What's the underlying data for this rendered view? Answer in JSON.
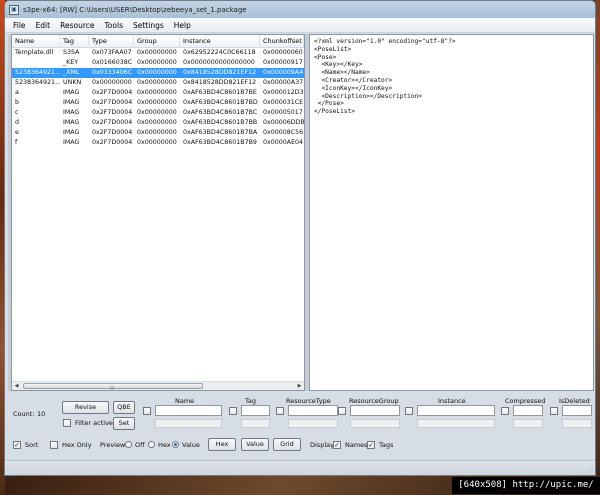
{
  "window": {
    "title": "s3pe-x64: [RW] C:\\Users\\USER\\Desktop\\zebeeya_set_1.package"
  },
  "menu": [
    {
      "label": "File"
    },
    {
      "label": "Edit"
    },
    {
      "label": "Resource"
    },
    {
      "label": "Tools"
    },
    {
      "label": "Settings"
    },
    {
      "label": "Help"
    }
  ],
  "list": {
    "columns": [
      "Name",
      "Tag",
      "Type",
      "Group",
      "Instance",
      "Chunkoffset"
    ],
    "rows": [
      {
        "name": "Template.dll",
        "tag": "S3SA",
        "type": "0x073FAA07",
        "group": "0x00000000",
        "instance": "0x62952224C0C66118",
        "chunk": "0x00000060",
        "selected": false
      },
      {
        "name": "",
        "tag": "_KEY",
        "type": "0x0166038C",
        "group": "0x00000000",
        "instance": "0x0000000000000000",
        "chunk": "0x00000917",
        "selected": false
      },
      {
        "name": "5238364921...",
        "tag": "_XML",
        "type": "0x0333406C",
        "group": "0x00000000",
        "instance": "0x8418528DD821EF12",
        "chunk": "0x000009A4",
        "selected": true
      },
      {
        "name": "5238364921...",
        "tag": "UNKN",
        "type": "0x00000000",
        "group": "0x00000000",
        "instance": "0x8418528DD821EF12",
        "chunk": "0x00000A37",
        "selected": false
      },
      {
        "name": "a",
        "tag": "IMAG",
        "type": "0x2F7D0004",
        "group": "0x00000000",
        "instance": "0xAF63BD4C8601B7BE",
        "chunk": "0x000012D3",
        "selected": false
      },
      {
        "name": "b",
        "tag": "IMAG",
        "type": "0x2F7D0004",
        "group": "0x00000000",
        "instance": "0xAF63BD4C8601B7BD",
        "chunk": "0x000031CE",
        "selected": false
      },
      {
        "name": "c",
        "tag": "IMAG",
        "type": "0x2F7D0004",
        "group": "0x00000000",
        "instance": "0xAF63BD4C8601B7BC",
        "chunk": "0x00005017",
        "selected": false
      },
      {
        "name": "d",
        "tag": "IMAG",
        "type": "0x2F7D0004",
        "group": "0x00000000",
        "instance": "0xAF63BD4C8601B7BB",
        "chunk": "0x00006DDB",
        "selected": false
      },
      {
        "name": "e",
        "tag": "IMAG",
        "type": "0x2F7D0004",
        "group": "0x00000000",
        "instance": "0xAF63BD4C8601B7BA",
        "chunk": "0x00008C56",
        "selected": false
      },
      {
        "name": "f",
        "tag": "IMAG",
        "type": "0x2F7D0004",
        "group": "0x00000000",
        "instance": "0xAF63BD4C8601B7B9",
        "chunk": "0x0000AE04",
        "selected": false
      }
    ]
  },
  "xml_preview": {
    "lines": [
      "<?xml version=\"1.0\" encoding=\"utf-8\"?>",
      "<PoseList>",
      "<Pose>",
      "  <Key></Key>",
      "  <Name></Name>",
      "  <Creator></Creator>",
      "  <IconKey></IconKey>",
      "  <Description></Description>",
      " </Pose>",
      "</PoseList>"
    ]
  },
  "controls": {
    "count_label": "Count:",
    "count_value": "10",
    "revise_label": "Revise",
    "qbe_label": "QBE",
    "filter_active_label": "Filter active",
    "set_label": "Set",
    "filter_headers": {
      "name": "Name",
      "tag": "Tag",
      "resource_type": "ResourceType",
      "resource_group": "ResourceGroup",
      "instance": "Instance",
      "compressed": "Compressed",
      "is_deleted": "IsDeleted"
    },
    "sort_label": "Sort",
    "sort_checked": true,
    "hex_only_label": "Hex Only",
    "hex_only_checked": false,
    "preview_label": "Preview:",
    "preview_options": [
      "Off",
      "Hex",
      "Value"
    ],
    "preview_selected": "Value",
    "hex_button": "Hex",
    "value_button": "Value",
    "grid_button": "Grid",
    "display_label": "Display:",
    "names_label": "Names",
    "names_checked": true,
    "tags_label": "Tags",
    "tags_checked": true
  },
  "watermark": "[640x508] http://upic.me/",
  "colors": {
    "selection": "#3399ff",
    "window_bg": "#d7dde4"
  }
}
